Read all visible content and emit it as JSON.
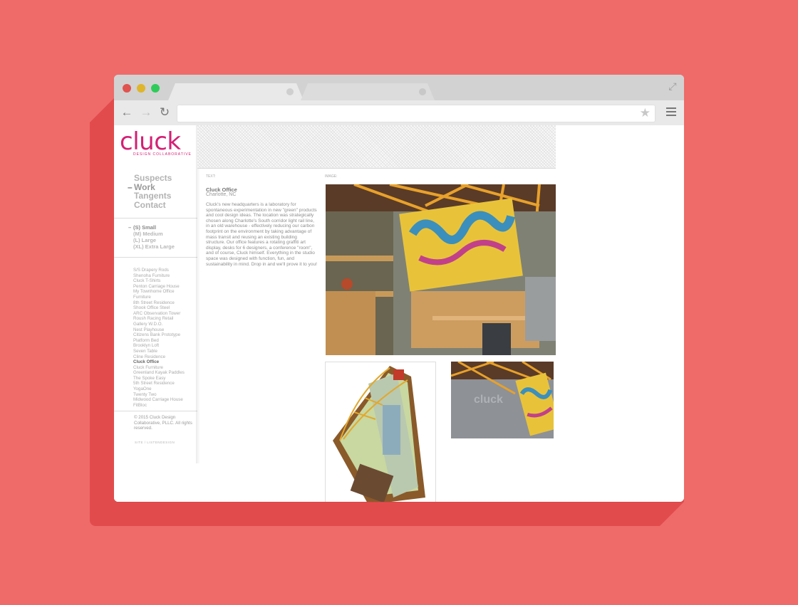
{
  "browser": {
    "tabs": [
      {
        "label": ""
      },
      {
        "label": ""
      }
    ],
    "address_url": ""
  },
  "site": {
    "logo": "cluck",
    "logo_sub": "DESIGN COLLABORATIVE",
    "main_nav": [
      "Suspects",
      "Work",
      "Tangents",
      "Contact"
    ],
    "size_nav": [
      "(S) Small",
      "(M) Medium",
      "(L) Large",
      "(XL) Extra Large"
    ],
    "projects": [
      "S/S Drapery Rods",
      "Shenoha Furniture",
      "Cluck T-Shirts",
      "Penton Carriage House",
      "My Townhome Office",
      "Furniture",
      "8th Street Residence",
      "Shook Office Steel",
      "ARC Observation Tower",
      "Roush Racing Retail",
      "Gallery W.D.O.",
      "Nest Playhouse",
      "Citizens Bank Prototype",
      "Platform Bed",
      "Brooklyn Loft",
      "Seven Table",
      "Cline Residence",
      "Cluck Office",
      "Cluck Furniture",
      "Greenland Kayak Paddles",
      "The Spoke Easy",
      "5th Street Residence",
      "YogaOne",
      "Twenty Two",
      "Midwood Carriage House",
      "FitBloc"
    ],
    "current_project_index": 17,
    "copyright": "© 2015 Cluck Design Collaborative, PLLC. All rights reserved.",
    "credit": "SITE / LISTENDESIGN"
  },
  "content": {
    "label_text": "TEXT:",
    "label_image": "IMAGE:",
    "title": "Cluck Office",
    "location": "Charlotte, NC",
    "description": "Cluck's new headquarters is a laboratory for spontaneous experimentation in new \"green\" products and cool design ideas. The location was strategically chosen along Charlotte's South corridor light rail line, in an old warehouse - effectively reducing our carbon footprint on the environment by taking advantage of mass transit and reusing an existing building structure. Our office features a rotating graffiti art display, desks for 6 designers, a conference \"room\", and of course, Cluck himself. Everything in the studio space was designed with function, fun, and sustainability in mind. Drop in and we'll prove it to you!"
  },
  "colors": {
    "background": "#ee6b6a",
    "shadow": "#e24b4c",
    "brand": "#d42074"
  },
  "icons": [
    "back-arrow-icon",
    "forward-arrow-icon",
    "reload-icon",
    "star-icon",
    "menu-icon",
    "expand-icon"
  ]
}
